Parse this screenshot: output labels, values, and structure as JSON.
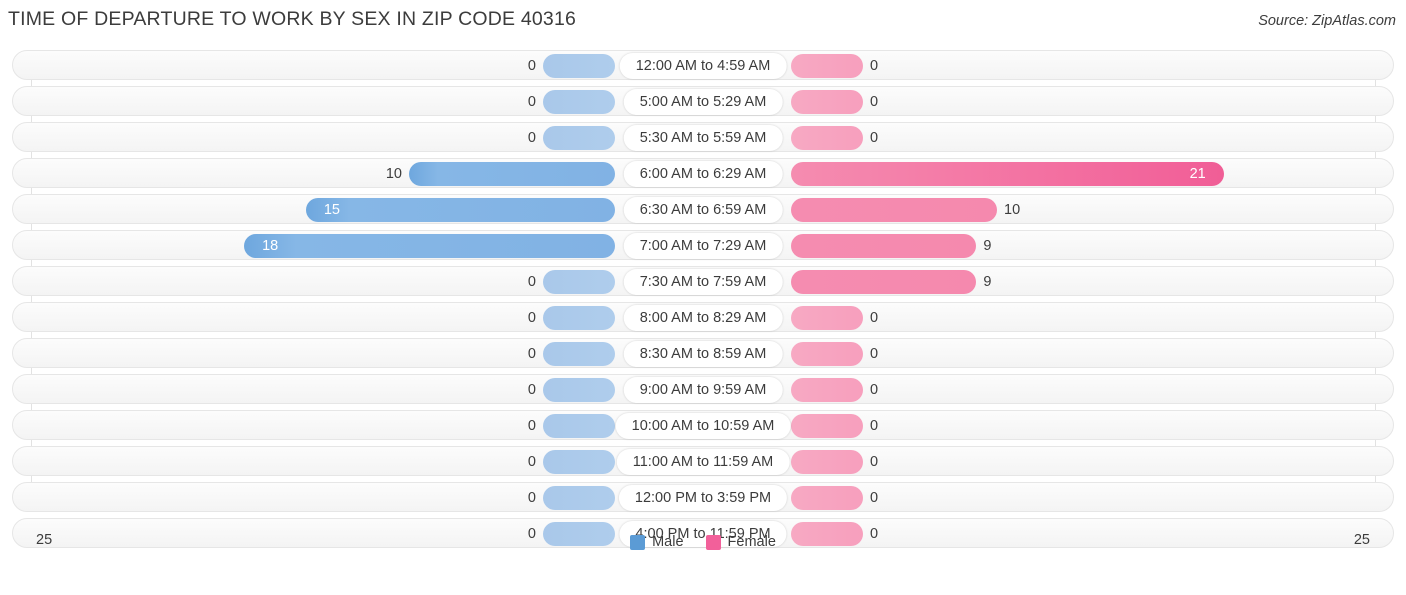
{
  "header": {
    "title": "TIME OF DEPARTURE TO WORK BY SEX IN ZIP CODE 40316",
    "source": "Source: ZipAtlas.com"
  },
  "axis": {
    "left_max": "25",
    "right_max": "25"
  },
  "legend": {
    "items": [
      {
        "label": "Male",
        "color": "#5b9bd5"
      },
      {
        "label": "Female",
        "color": "#f2609a"
      }
    ]
  },
  "colors": {
    "male": "#7cade2",
    "male_zero": "#acccec",
    "female": "#f589ae",
    "female_dark": "#f2639a",
    "female_zero": "#f7a4c0",
    "title": "#3c3c3c",
    "row_bg": "#f7f7f7",
    "row_border": "#e6e6e6"
  },
  "chart_data": {
    "type": "bar",
    "title": "TIME OF DEPARTURE TO WORK BY SEX IN ZIP CODE 40316",
    "subtitle": "",
    "xlabel": "",
    "ylabel": "",
    "orientation": "horizontal-diverging",
    "xlim": [
      25,
      0,
      25
    ],
    "grid": true,
    "legend_position": "bottom-center",
    "categories": [
      "12:00 AM to 4:59 AM",
      "5:00 AM to 5:29 AM",
      "5:30 AM to 5:59 AM",
      "6:00 AM to 6:29 AM",
      "6:30 AM to 6:59 AM",
      "7:00 AM to 7:29 AM",
      "7:30 AM to 7:59 AM",
      "8:00 AM to 8:29 AM",
      "8:30 AM to 8:59 AM",
      "9:00 AM to 9:59 AM",
      "10:00 AM to 10:59 AM",
      "11:00 AM to 11:59 AM",
      "12:00 PM to 3:59 PM",
      "4:00 PM to 11:59 PM"
    ],
    "series": [
      {
        "name": "Male",
        "values": [
          0,
          0,
          0,
          10,
          15,
          18,
          0,
          0,
          0,
          0,
          0,
          0,
          0,
          0
        ]
      },
      {
        "name": "Female",
        "values": [
          0,
          0,
          0,
          21,
          10,
          9,
          9,
          0,
          0,
          0,
          0,
          0,
          0,
          0
        ]
      }
    ]
  },
  "rows": [
    {
      "category": "12:00 AM to 4:59 AM",
      "male": "0",
      "female": "0"
    },
    {
      "category": "5:00 AM to 5:29 AM",
      "male": "0",
      "female": "0"
    },
    {
      "category": "5:30 AM to 5:59 AM",
      "male": "0",
      "female": "0"
    },
    {
      "category": "6:00 AM to 6:29 AM",
      "male": "10",
      "female": "21"
    },
    {
      "category": "6:30 AM to 6:59 AM",
      "male": "15",
      "female": "10"
    },
    {
      "category": "7:00 AM to 7:29 AM",
      "male": "18",
      "female": "9"
    },
    {
      "category": "7:30 AM to 7:59 AM",
      "male": "0",
      "female": "9"
    },
    {
      "category": "8:00 AM to 8:29 AM",
      "male": "0",
      "female": "0"
    },
    {
      "category": "8:30 AM to 8:59 AM",
      "male": "0",
      "female": "0"
    },
    {
      "category": "9:00 AM to 9:59 AM",
      "male": "0",
      "female": "0"
    },
    {
      "category": "10:00 AM to 10:59 AM",
      "male": "0",
      "female": "0"
    },
    {
      "category": "11:00 AM to 11:59 AM",
      "male": "0",
      "female": "0"
    },
    {
      "category": "12:00 PM to 3:59 PM",
      "male": "0",
      "female": "0"
    },
    {
      "category": "4:00 PM to 11:59 PM",
      "male": "0",
      "female": "0"
    }
  ]
}
